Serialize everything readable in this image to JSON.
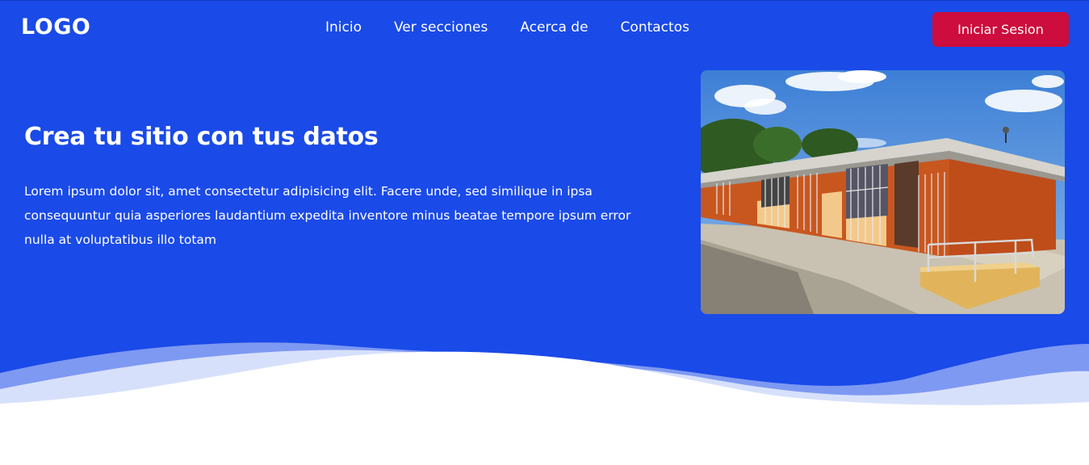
{
  "header": {
    "logo": "LOGO",
    "nav": [
      "Inicio",
      "Ver secciones",
      "Acerca de",
      "Contactos"
    ],
    "login_label": "Iniciar Sesion"
  },
  "hero": {
    "title": "Crea tu sitio con tus datos",
    "description": "Lorem ipsum dolor sit, amet consectetur adipisicing elit. Facere unde, sed similique in ipsa consequuntur quia asperiores laudantium expedita inventore minus beatae tempore ipsum error nulla at voluptatibus illo totam"
  },
  "colors": {
    "primary": "#1a4ae8",
    "accent_button": "#cc0d3d",
    "text_on_primary": "#ffffff"
  }
}
